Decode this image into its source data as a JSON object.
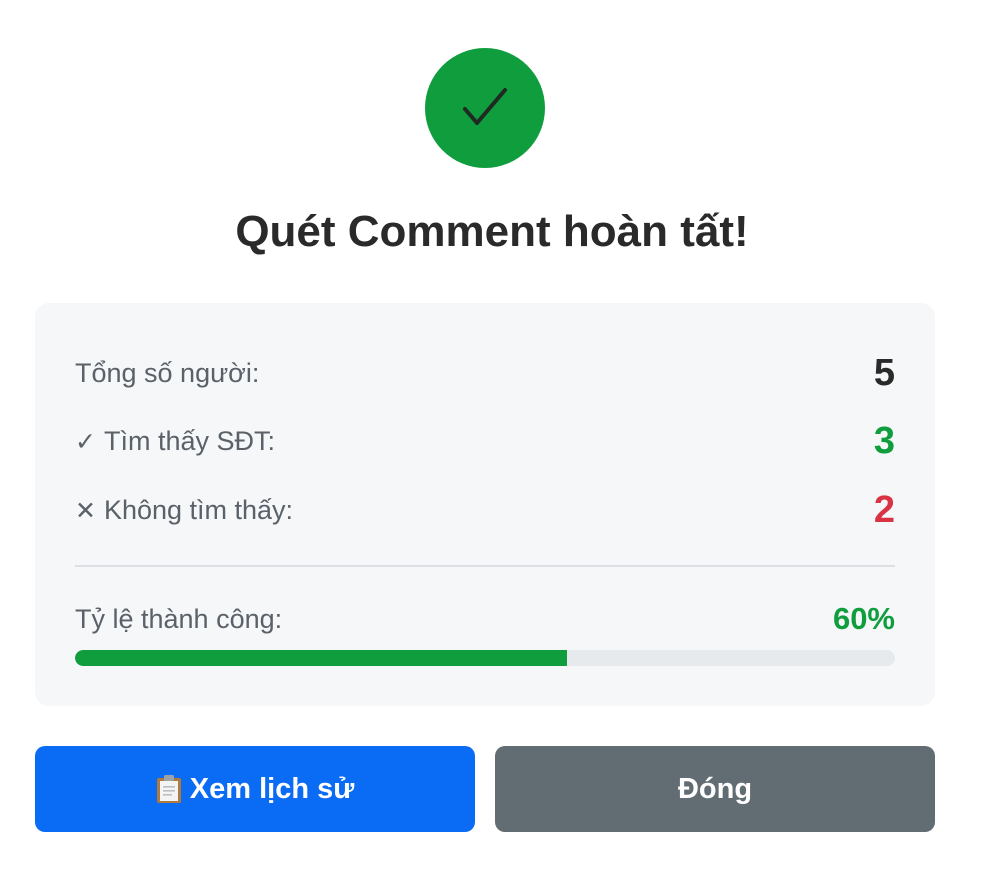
{
  "header": {
    "icon": "checkmark-icon",
    "title": "Quét Comment hoàn tất!"
  },
  "stats": {
    "total_label": "Tổng số người:",
    "total_value": "5",
    "found_mark": "✓",
    "found_label": "Tìm thấy SĐT:",
    "found_value": "3",
    "notfound_mark": "✕",
    "notfound_label": "Không tìm thấy:",
    "notfound_value": "2",
    "rate_label": "Tỷ lệ thành công:",
    "rate_value": "60%",
    "rate_fraction": 0.6
  },
  "actions": {
    "history_icon": "clipboard-icon",
    "history_label": "Xem lịch sử",
    "close_label": "Đóng"
  },
  "colors": {
    "success": "#0f9d3e",
    "danger": "#d93344",
    "primary": "#0a6cf5",
    "secondary": "#626c73"
  }
}
